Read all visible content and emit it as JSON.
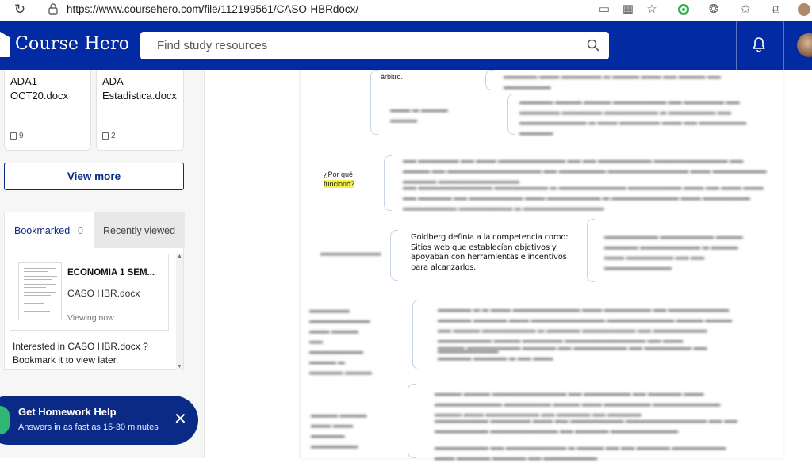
{
  "browser": {
    "url": "https://www.coursehero.com/file/112199561/CASO-HBRdocx/",
    "icons": [
      "reload-icon",
      "lock-icon",
      "cast-icon",
      "qr-icon",
      "star-add-icon",
      "extension-icon",
      "puzzle-icon",
      "favorites-icon",
      "collections-icon",
      "profile-icon"
    ]
  },
  "header": {
    "brand": "Course Hero",
    "search_placeholder": "Find study resources",
    "brand_color": "#012aa3"
  },
  "sidebar": {
    "cards": [
      {
        "title": "ADA1 OCT20.docx",
        "count": "9"
      },
      {
        "title": "ADA Estadistica.docx",
        "count": "2"
      }
    ],
    "view_more": "View more",
    "tabs": {
      "bookmarked": "Bookmarked",
      "bookmarked_count": "0",
      "recent": "Recently viewed"
    },
    "recent_item": {
      "title": "ECONOMIA 1 SEM...",
      "subtitle": "CASO HBR.docx",
      "status": "Viewing now"
    },
    "note": "Interested in CASO HBR.docx ? Bookmark it to view later."
  },
  "homework": {
    "title": "Get Homework Help",
    "subtitle": "Answers in as fast as 15-30 minutes",
    "close": "✕"
  },
  "document": {
    "arbitro": "árbitro.",
    "question_line1": "¿Por qué",
    "question_line2": "funcionó?",
    "goldberg": "Goldberg definía a la competencia como: Sitios web que establecían objetivos y apoyaban con herramientas e incentivos para alcanzarlos."
  }
}
